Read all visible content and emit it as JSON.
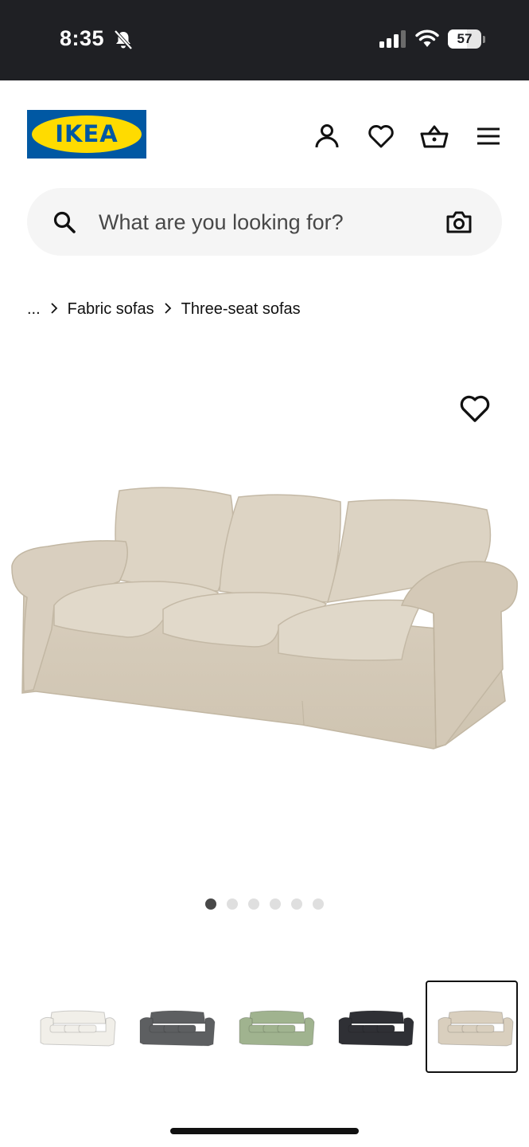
{
  "status_bar": {
    "time": "8:35",
    "battery": "57",
    "battery_fraction": 0.57,
    "icons": [
      "bell-slash-icon",
      "cellular-signal-icon",
      "wifi-icon",
      "battery-icon"
    ]
  },
  "header": {
    "logo_text": "IKEA",
    "icons": [
      "account-icon",
      "heart-icon",
      "shopping-basket-icon",
      "menu-icon"
    ]
  },
  "search": {
    "placeholder": "What are you looking for?",
    "icons": [
      "search-icon",
      "camera-icon"
    ]
  },
  "breadcrumb": {
    "items": [
      "...",
      "Fabric sofas",
      "Three-seat sofas"
    ]
  },
  "product": {
    "image": "beige-three-seat-sofa",
    "favorite_icon": "heart-icon"
  },
  "carousel": {
    "page_count": 6,
    "active_index": 0
  },
  "color_variants": [
    {
      "color": "#f1efe9",
      "selected": false
    },
    {
      "color": "#5d5f61",
      "selected": false
    },
    {
      "color": "#a0b38f",
      "selected": false
    },
    {
      "color": "#2f3035",
      "selected": false
    },
    {
      "color": "#d9cfbe",
      "selected": true
    }
  ],
  "colors": {
    "status_bar": "#1f2024",
    "ikea_blue": "#0058a3",
    "ikea_yellow": "#ffdb00",
    "sofa_beige": "#d9cfbe",
    "search_bg": "#f5f5f5"
  }
}
